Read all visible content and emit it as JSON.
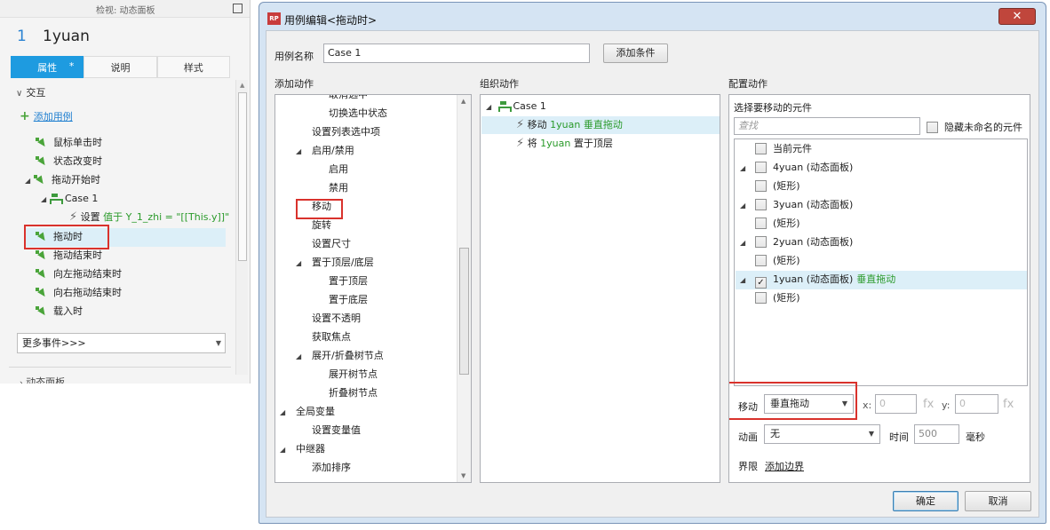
{
  "left_panel": {
    "top_title": "检视: 动态面板",
    "page_number": "1",
    "page_name": "1yuan",
    "tabs": [
      {
        "label": "属性"
      },
      {
        "label": "说明"
      },
      {
        "label": "样式"
      }
    ],
    "section_title": "交互",
    "add_case": "添加用例",
    "events": [
      {
        "label": "鼠标单击时"
      },
      {
        "label": "状态改变时"
      },
      {
        "label": "拖动开始时"
      }
    ],
    "case_label": "Case 1",
    "action_prefix": "设置",
    "action_detail": "值于 Y_1_zhi = \"[[This.y]]\"",
    "events_after": [
      {
        "label": "拖动时"
      },
      {
        "label": "拖动结束时"
      },
      {
        "label": "向左拖动结束时"
      },
      {
        "label": "向右拖动结束时"
      },
      {
        "label": "载入时"
      }
    ],
    "more_events": "更多事件>>>",
    "bottom_cut": "动态面板"
  },
  "dialog": {
    "title": "用例编辑<拖动时>",
    "icon_text": "RP",
    "case_name_label": "用例名称",
    "case_name_value": "Case 1",
    "add_condition": "添加条件",
    "col_add_action": "添加动作",
    "col_organize": "组织动作",
    "col_configure": "配置动作",
    "add_actions": [
      {
        "label": "取消选中",
        "indent": 2
      },
      {
        "label": "切换选中状态",
        "indent": 2
      },
      {
        "label": "设置列表选中项",
        "indent": 1
      },
      {
        "label": "启用/禁用",
        "indent": 1,
        "tri": true
      },
      {
        "label": "启用",
        "indent": 2
      },
      {
        "label": "禁用",
        "indent": 2
      },
      {
        "label": "移动",
        "indent": 1
      },
      {
        "label": "旋转",
        "indent": 1
      },
      {
        "label": "设置尺寸",
        "indent": 1
      },
      {
        "label": "置于顶层/底层",
        "indent": 1,
        "tri": true
      },
      {
        "label": "置于顶层",
        "indent": 2
      },
      {
        "label": "置于底层",
        "indent": 2
      },
      {
        "label": "设置不透明",
        "indent": 1
      },
      {
        "label": "获取焦点",
        "indent": 1
      },
      {
        "label": "展开/折叠树节点",
        "indent": 1,
        "tri": true
      },
      {
        "label": "展开树节点",
        "indent": 2
      },
      {
        "label": "折叠树节点",
        "indent": 2
      },
      {
        "label": "全局变量",
        "indent": 0,
        "tri": true
      },
      {
        "label": "设置变量值",
        "indent": 1
      },
      {
        "label": "中继器",
        "indent": 0,
        "tri": true
      },
      {
        "label": "添加排序",
        "indent": 1
      }
    ],
    "organize": {
      "case": "Case 1",
      "actions": [
        {
          "prefix": "移动",
          "target": "1yuan",
          "detail": "垂直拖动"
        },
        {
          "prefix": "将",
          "target": "1yuan",
          "detail": "置于顶层"
        }
      ]
    },
    "configure": {
      "select_label": "选择要移动的元件",
      "search_placeholder": "查找",
      "hide_unnamed": "隐藏未命名的元件",
      "widgets": [
        {
          "label": "当前元件",
          "level": 1,
          "checked": false,
          "tri": false,
          "suffix": ""
        },
        {
          "label": "4yuan (动态面板)",
          "level": 0,
          "checked": false,
          "tri": true,
          "suffix": ""
        },
        {
          "label": "(矩形)",
          "level": 1,
          "checked": false,
          "tri": false,
          "suffix": ""
        },
        {
          "label": "3yuan (动态面板)",
          "level": 0,
          "checked": false,
          "tri": true,
          "suffix": ""
        },
        {
          "label": "(矩形)",
          "level": 1,
          "checked": false,
          "tri": false,
          "suffix": ""
        },
        {
          "label": "2yuan (动态面板)",
          "level": 0,
          "checked": false,
          "tri": true,
          "suffix": ""
        },
        {
          "label": "(矩形)",
          "level": 1,
          "checked": false,
          "tri": false,
          "suffix": ""
        },
        {
          "label": "1yuan (动态面板)",
          "level": 0,
          "checked": true,
          "tri": true,
          "suffix": "垂直拖动"
        },
        {
          "label": "(矩形)",
          "level": 1,
          "checked": false,
          "tri": false,
          "suffix": ""
        }
      ],
      "move_label": "移动",
      "move_value": "垂直拖动",
      "x_label": "x:",
      "x_value": "0",
      "y_label": "y:",
      "y_value": "0",
      "fx": "fx",
      "anim_label": "动画",
      "anim_value": "无",
      "time_label": "时间",
      "time_value": "500",
      "ms": "毫秒",
      "bounds_label": "界限",
      "add_bounds": "添加边界"
    },
    "ok": "确定",
    "cancel": "取消"
  },
  "colors": {
    "accent_blue": "#1e9be0",
    "highlight_green": "#2a9a2a",
    "annotation_red": "#d9322c",
    "selection": "#dceff8"
  }
}
